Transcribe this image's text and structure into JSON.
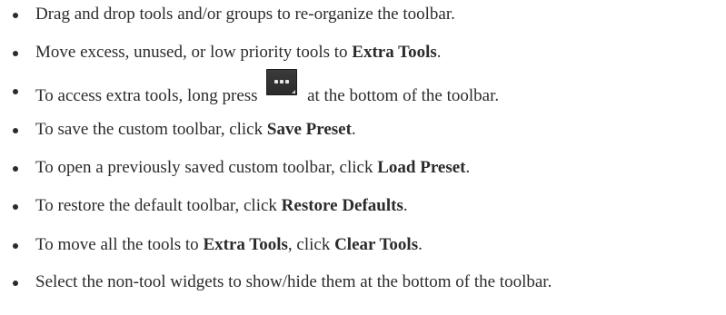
{
  "instructions": [
    {
      "segments": [
        {
          "text": "Drag and drop tools and/or groups to re-organize the toolbar.",
          "bold": false
        }
      ]
    },
    {
      "segments": [
        {
          "text": "Move excess, unused, or low priority tools to ",
          "bold": false
        },
        {
          "text": "Extra Tools",
          "bold": true
        },
        {
          "text": ".",
          "bold": false
        }
      ]
    },
    {
      "segments": [
        {
          "text": "To access extra tools, long press ",
          "bold": false
        },
        {
          "icon": "more-tools-icon"
        },
        {
          "text": " at the bottom of the toolbar.",
          "bold": false
        }
      ]
    },
    {
      "segments": [
        {
          "text": "To save the custom toolbar, click ",
          "bold": false
        },
        {
          "text": "Save Preset",
          "bold": true
        },
        {
          "text": ".",
          "bold": false
        }
      ]
    },
    {
      "segments": [
        {
          "text": "To open a previously saved custom toolbar, click ",
          "bold": false
        },
        {
          "text": "Load Preset",
          "bold": true
        },
        {
          "text": ".",
          "bold": false
        }
      ]
    },
    {
      "segments": [
        {
          "text": "To restore the default toolbar, click ",
          "bold": false
        },
        {
          "text": "Restore Defaults",
          "bold": true
        },
        {
          "text": ".",
          "bold": false
        }
      ]
    },
    {
      "segments": [
        {
          "text": "To move all the tools to ",
          "bold": false
        },
        {
          "text": "Extra Tools",
          "bold": true
        },
        {
          "text": ", click ",
          "bold": false
        },
        {
          "text": "Clear Tools",
          "bold": true
        },
        {
          "text": ".",
          "bold": false
        }
      ]
    },
    {
      "segments": [
        {
          "text": "Select the non-tool widgets to show/hide them at the bottom of the toolbar.",
          "bold": false
        }
      ]
    }
  ],
  "colors": {
    "text": "#2b2b2b",
    "icon_background": "#333333",
    "icon_dots": "#e6e6e6"
  }
}
